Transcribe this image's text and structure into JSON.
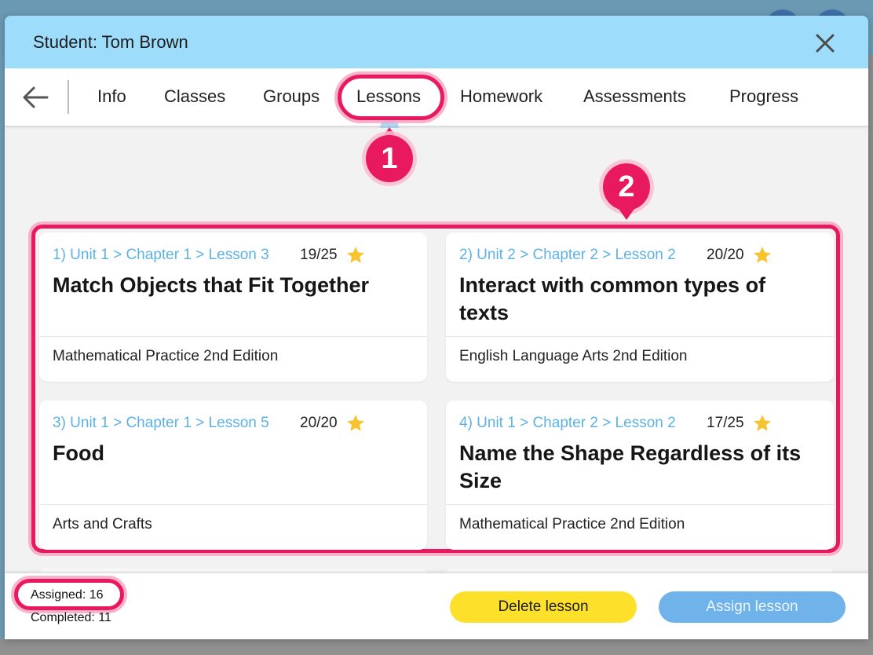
{
  "modal": {
    "title": "Student: Tom Brown"
  },
  "tabs": [
    {
      "label": "Info"
    },
    {
      "label": "Classes"
    },
    {
      "label": "Groups"
    },
    {
      "label": "Lessons"
    },
    {
      "label": "Homework"
    },
    {
      "label": "Assessments"
    },
    {
      "label": "Progress"
    }
  ],
  "active_tab": "Lessons",
  "callouts": {
    "one": "1",
    "two": "2"
  },
  "lessons": [
    {
      "path": "1) Unit 1 > Chapter 1 > Lesson 3",
      "score": "19/25",
      "title": "Match Objects that Fit Together",
      "book": "Mathematical Practice 2nd Edition"
    },
    {
      "path": "2) Unit 2 > Chapter 2 > Lesson 2",
      "score": "20/20",
      "title": "Interact with common types of texts",
      "book": "English Language Arts 2nd Edition"
    },
    {
      "path": "3) Unit 1 > Chapter 1 > Lesson 5",
      "score": "20/20",
      "title": "Food",
      "book": "Arts and Crafts"
    },
    {
      "path": "4) Unit 1 > Chapter 2 > Lesson 2",
      "score": "17/25",
      "title": "Name the Shape Regardless of its Size",
      "book": "Mathematical Practice 2nd Edition"
    }
  ],
  "footer": {
    "assigned": "Assigned: 16",
    "completed": "Completed: 11",
    "delete_label": "Delete lesson",
    "assign_label": "Assign lesson"
  },
  "icons": {
    "close": "close-icon",
    "back": "arrow-left-icon",
    "star": "star-icon"
  },
  "colors": {
    "header": "#9edcfc",
    "highlight": "#e8195f",
    "path_link": "#5db2e4",
    "star": "#f7c32e",
    "delete_button": "#fde02a",
    "assign_button": "#70b3ea"
  }
}
